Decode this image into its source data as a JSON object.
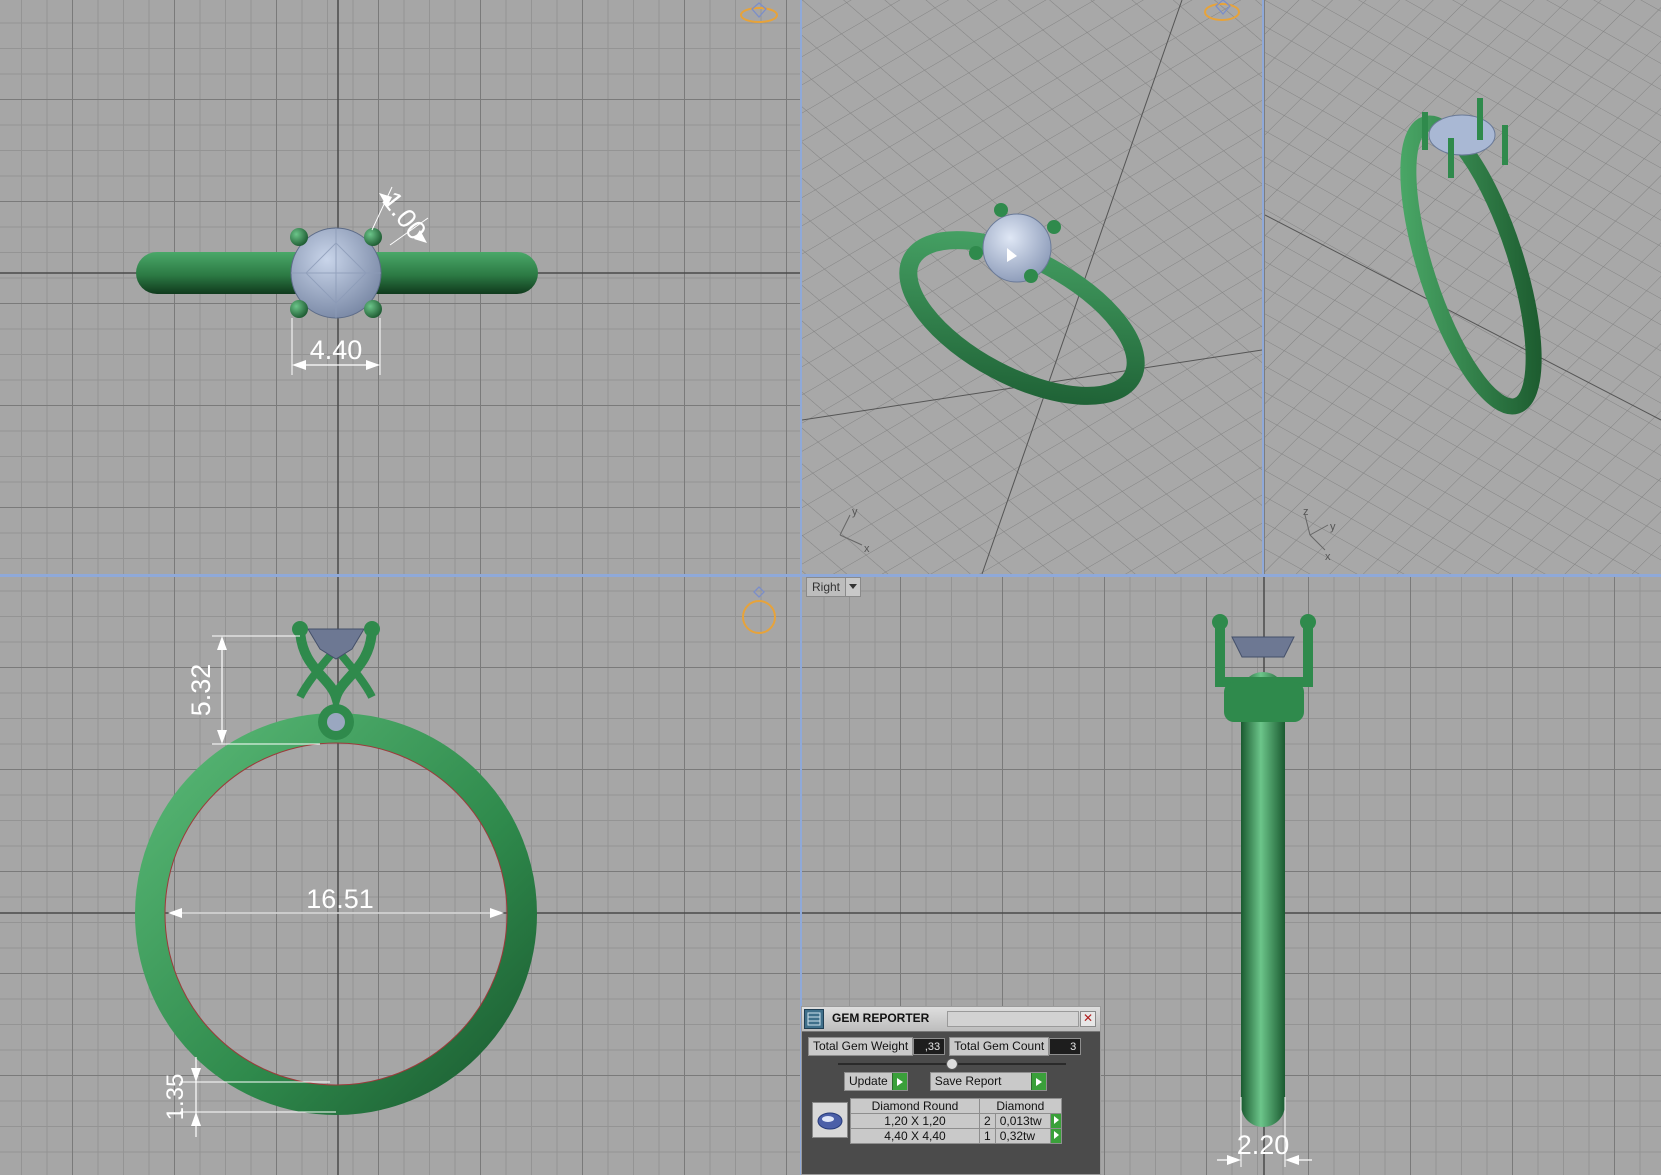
{
  "viewports": {
    "top": {
      "dims": {
        "prong": "1.00",
        "gem_width": "4.40"
      }
    },
    "front": {
      "dims": {
        "head_height": "5.32",
        "inner_diameter": "16.51",
        "shank_thickness": "1.35"
      }
    },
    "right": {
      "view_label": "Right",
      "dims": {
        "shank_width": "2.20"
      }
    },
    "persp_left": {
      "axes": {
        "x": "x",
        "y": "y"
      }
    },
    "persp_right": {
      "axes": {
        "x": "x",
        "y": "y",
        "z": "z"
      }
    }
  },
  "gem_reporter": {
    "title": "GEM REPORTER",
    "total_weight_label": "Total Gem Weight",
    "total_weight_value": ",33",
    "total_count_label": "Total Gem Count",
    "total_count_value": "3",
    "update_label": "Update",
    "save_report_label": "Save Report",
    "table": {
      "headers": [
        "Diamond Round",
        "Diamond"
      ],
      "rows": [
        {
          "size": "1,20 X 1,20",
          "qty": "2",
          "weight": "0,013tw"
        },
        {
          "size": "4,40 X 4,40",
          "qty": "1",
          "weight": "0,32tw"
        }
      ]
    }
  },
  "colors": {
    "metal": "#2f8a4c",
    "gem": "#a9b8d4",
    "grid_bg": "#a6a6a6",
    "separator": "#8fa9d9",
    "accent_orange": "#e7a33a"
  }
}
